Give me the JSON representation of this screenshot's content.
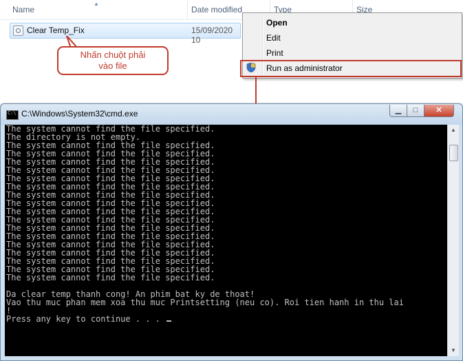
{
  "explorer": {
    "columns": {
      "name": "Name",
      "date_modified": "Date modified",
      "type": "Type",
      "size": "Size"
    },
    "file": {
      "name": "Clear Temp_Fix",
      "date": "15/09/2020 10",
      "icon": "batch-file-icon"
    }
  },
  "callout": {
    "line1": "Nhấn chuột phải",
    "line2": "vào file"
  },
  "context_menu": {
    "open": "Open",
    "edit": "Edit",
    "print": "Print",
    "run_as_admin": "Run as administrator",
    "highlight_color": "#c0392b"
  },
  "cmd": {
    "title": "C:\\Windows\\System32\\cmd.exe",
    "lines": [
      "The system cannot find the file specified.",
      "The directory is not empty.",
      "The system cannot find the file specified.",
      "The system cannot find the file specified.",
      "The system cannot find the file specified.",
      "The system cannot find the file specified.",
      "The system cannot find the file specified.",
      "The system cannot find the file specified.",
      "The system cannot find the file specified.",
      "The system cannot find the file specified.",
      "The system cannot find the file specified.",
      "The system cannot find the file specified.",
      "The system cannot find the file specified.",
      "The system cannot find the file specified.",
      "The system cannot find the file specified.",
      "The system cannot find the file specified.",
      "The system cannot find the file specified.",
      "The system cannot find the file specified.",
      "The system cannot find the file specified.",
      "",
      "Da clear temp thanh cong! An phim bat ky de thoat!",
      "Vao thu muc phan mem xoa thu muc Printsetting (neu co). Roi tien hanh in thu lai",
      "!",
      "Press any key to continue . . . "
    ]
  }
}
